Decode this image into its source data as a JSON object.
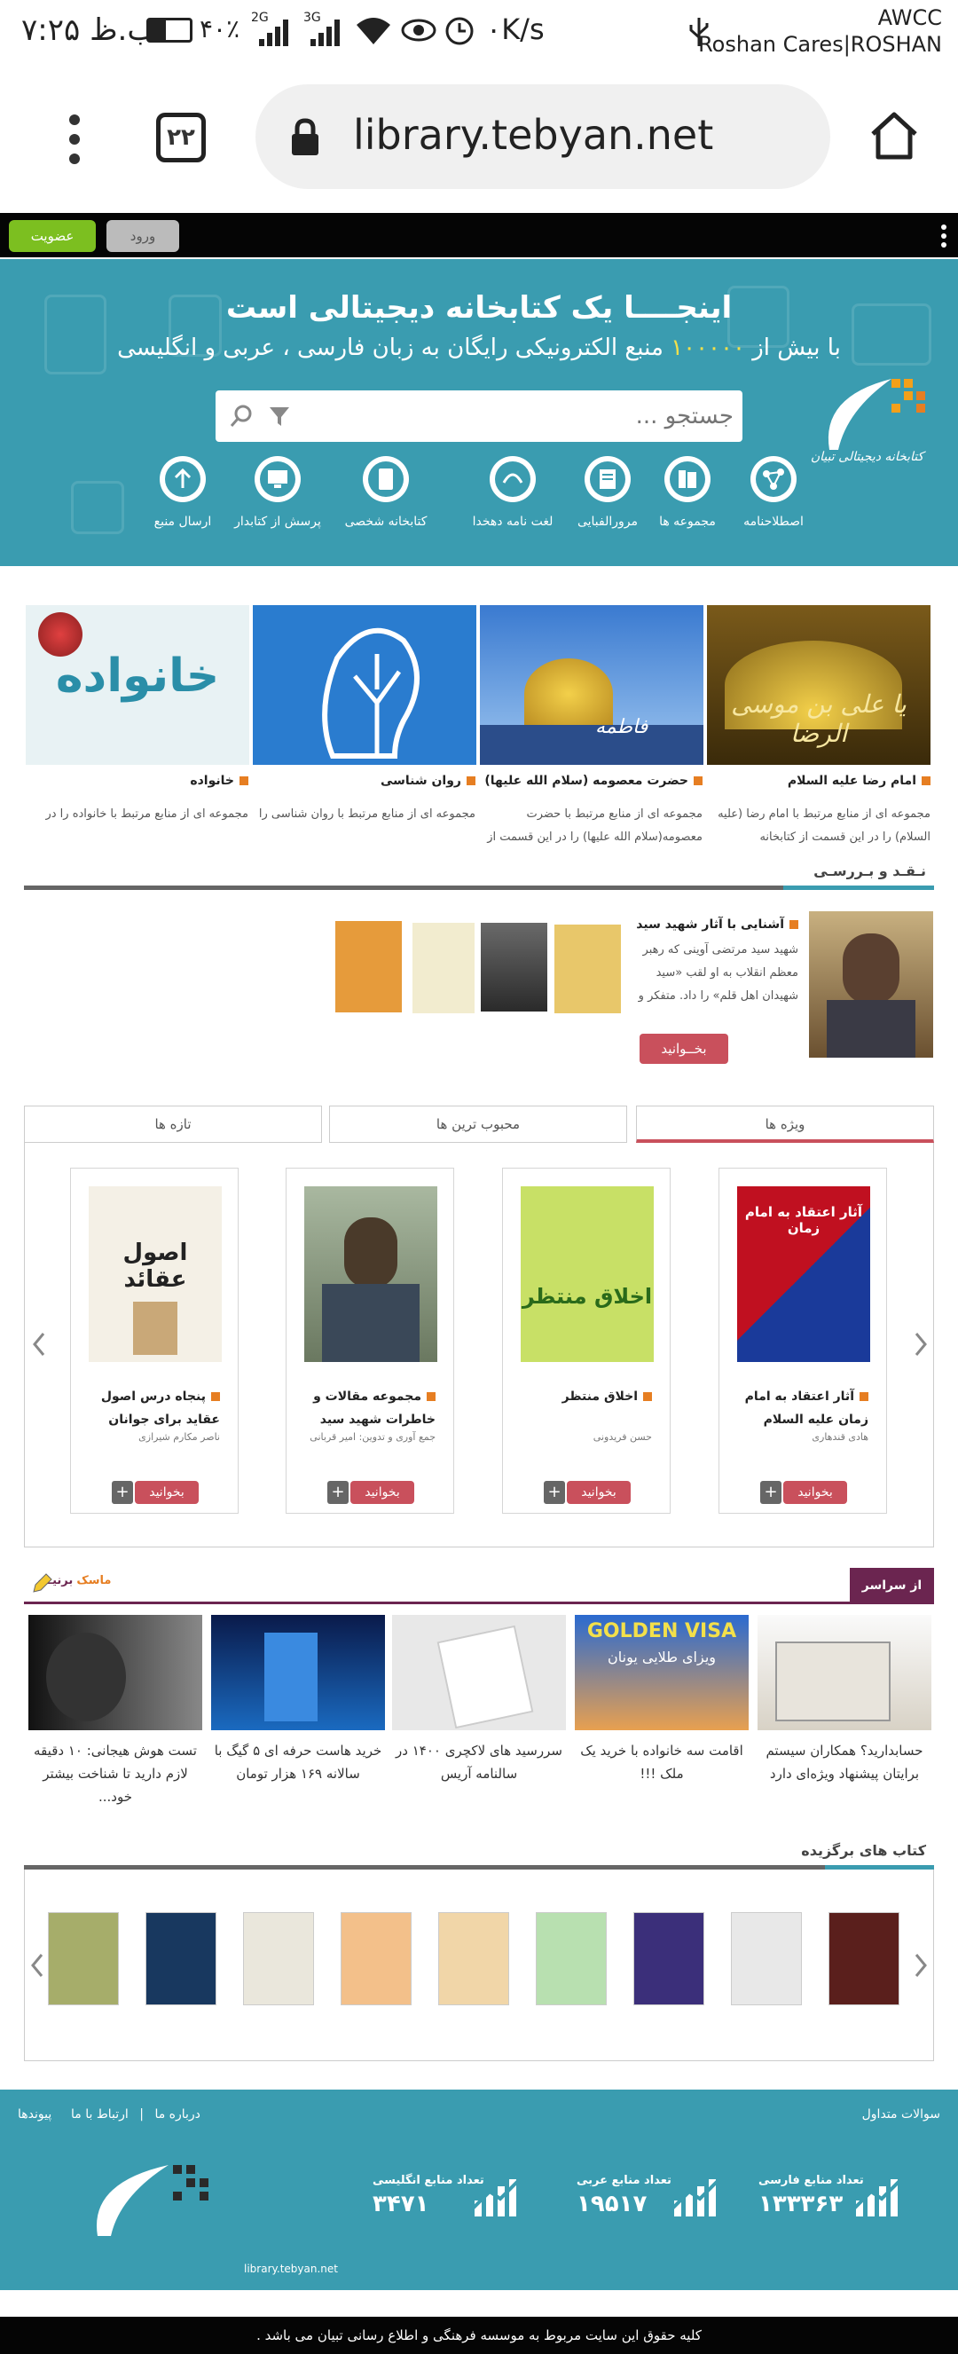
{
  "status_bar": {
    "time": "۷:۲۵ ب.ظ",
    "battery": "۴۰٪",
    "network_2g": "2G",
    "network_3g": "3G",
    "speed": "۰K/s",
    "carrier_line1": "AWCC",
    "carrier_line2": "Roshan Cares|ROSHAN"
  },
  "browser": {
    "url": "library.tebyan.net",
    "tab_count": "۲۲"
  },
  "top_bar": {
    "login_label": "ورود",
    "register_label": "عضویت"
  },
  "hero": {
    "title": "اینجــــا یک کتابخانه دیجیتالی است",
    "subtitle_prefix": "با بیش از",
    "subtitle_number": "۱۰۰۰۰۰",
    "subtitle_suffix": "منبع الکترونیکی رایگان به زبان فارسی ، عربی و انگلیسی",
    "search_placeholder": "جستجو ...",
    "logo_text": "کتابخانه دیجیتالی تبیان",
    "quick_links": [
      {
        "label": "اصطلاحنامه",
        "icon": "network-icon"
      },
      {
        "label": "مجموعه ها",
        "icon": "books-icon"
      },
      {
        "label": "مرورالفبایی",
        "icon": "book-icon"
      },
      {
        "label": "لغت نامه دهخدا",
        "icon": "dehkhoda-icon"
      },
      {
        "label": "کتابخانه شخصی",
        "icon": "tablet-icon"
      },
      {
        "label": "پرسش از کتابدار",
        "icon": "monitor-icon"
      },
      {
        "label": "ارسال منبع",
        "icon": "upload-icon"
      }
    ]
  },
  "featured": [
    {
      "title": "امام رضا علیه السلام",
      "desc": "مجموعه ای از منابع مرتبط با امام رضا (علیه السلام) را در این قسمت از کتابخانه",
      "image_text": "یا علی بن موسی الرضا"
    },
    {
      "title": "حضرت معصومه (سلام الله علیها)",
      "desc": "مجموعه ای از منابع مرتبط با حضرت معصومه(سلام الله علیها) را در این قسمت از",
      "image_text": "فاطمه"
    },
    {
      "title": "روان شناسی",
      "desc": "مجموعه ای از منابع مرتبط با روان شناسی را",
      "image_text": ""
    },
    {
      "title": "خانواده",
      "desc": "مجموعه ای از منابع مرتبط با خانواده را در",
      "image_text": "خانواده"
    }
  ],
  "review": {
    "section_title": "نـقـد و بـررسـی",
    "title": "آشنایی با آثار شهید سید",
    "desc": "شهید سید مرتضی آوینی که رهبر معظم انقلاب به او لقب «سید شهیدان اهل قلم» را داد. متفکر و",
    "read_button": "بخــوانید"
  },
  "tabs": [
    "ویژه ها",
    "محبوب ترین ها",
    "تازه ها"
  ],
  "books": [
    {
      "title": "آثار اعتقاد به امام زمان علیه السلام",
      "author": "هادی قندهاری",
      "read": "بخوانید",
      "cover_text": "آثار اعتقاد به امام زمان"
    },
    {
      "title": "اخلاق منتظر",
      "author": "حسن فریدونی",
      "read": "بخوانید",
      "cover_text": "اخلاق منتظر"
    },
    {
      "title": "مجموعه مقالات و خاطرات شهید سید",
      "author": "جمع آوری و تدوین: امیر قربانی",
      "read": "بخوانید",
      "cover_text": ""
    },
    {
      "title": "پنجاه درس اصول عقاید برای جوانان",
      "author": "ناصر مکارم شیرازی",
      "read": "بخوانید",
      "cover_text": "اصول عقائد"
    }
  ],
  "web_section": {
    "label": "از سراسر وب",
    "sponsor_label": "ماسک",
    "sponsor_suffix": "برنیــم"
  },
  "news": [
    {
      "caption": "حسابدارید؟ همکاران سیستم برایتان پیشنهاد ویژه‌ای دارد"
    },
    {
      "caption": "اقامت سه خانواده با خرید یک ملک !!!",
      "image_text": "GOLDEN VISA",
      "image_sub": "ویزای طلایی یونان"
    },
    {
      "caption": "سررسید های لاکچری ۱۴۰۰ در سالنامه آریس"
    },
    {
      "caption": "خرید هاست حرفه ای ۵ گیگ با سالانه ۱۶۹ هزار تومان"
    },
    {
      "caption": "تست هوش هیجانی: ۱۰ دقیقه لازم دارید تا شناخت بیشتر خود..."
    }
  ],
  "selected_books": {
    "section_title": "کتاب های برگزیده",
    "covers": [
      "#5a1f1c",
      "#e8e8e8",
      "#3b2f7a",
      "#b8e0b0",
      "#f1d6a8",
      "#f3c08a",
      "#eae7dc",
      "#18385f",
      "#a6ad6a"
    ]
  },
  "footer": {
    "links": [
      "سوالات متداول",
      "ارتباط با ما",
      "درباره ما",
      "پیوندها"
    ],
    "stats": [
      {
        "label": "تعداد منابع فارسی",
        "value": "۱۳۳۳۶۳"
      },
      {
        "label": "تعداد منابع عربی",
        "value": "۱۹۵۱۷"
      },
      {
        "label": "تعداد منابع انگلیسی",
        "value": "۳۴۷۱"
      }
    ],
    "site_url": "library.tebyan.net",
    "copyright": "کلیه حقوق این سایت مربوط به موسسه فرهنگی و اطلاع رسانی تبیان می باشد ."
  },
  "colors": {
    "brand_teal": "#3a9cb0",
    "accent_red": "#c9505c",
    "accent_orange": "#e67e22",
    "register_green": "#7cbf20"
  }
}
